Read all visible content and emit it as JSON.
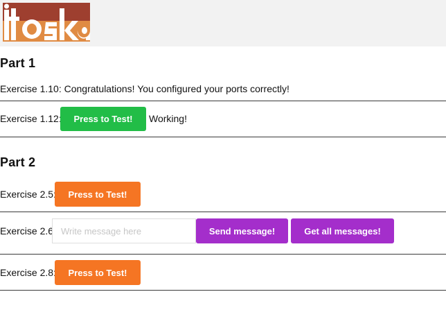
{
  "brand": {
    "logo_text": "itoska",
    "colors": {
      "dark": "#9e3f2f",
      "light": "#e08b43"
    }
  },
  "part1": {
    "title": "Part 1",
    "ex110": {
      "text": "Exercise 1.10: Congratulations! You configured your ports correctly!"
    },
    "ex112": {
      "label": "Exercise 1.12:",
      "button": "Press to Test!",
      "status": "Working!"
    }
  },
  "part2": {
    "title": "Part 2",
    "ex25": {
      "label": "Exercise 2.5:",
      "button": "Press to Test!"
    },
    "ex26": {
      "label": "Exercise 2.6:",
      "placeholder": "Write message here",
      "value": "",
      "send_button": "Send message!",
      "get_button": "Get all messages!"
    },
    "ex28": {
      "label": "Exercise 2.8:",
      "button": "Press to Test!"
    }
  },
  "colors": {
    "green": "#22bd47",
    "orange": "#f57523",
    "purple": "#a42ecb"
  }
}
